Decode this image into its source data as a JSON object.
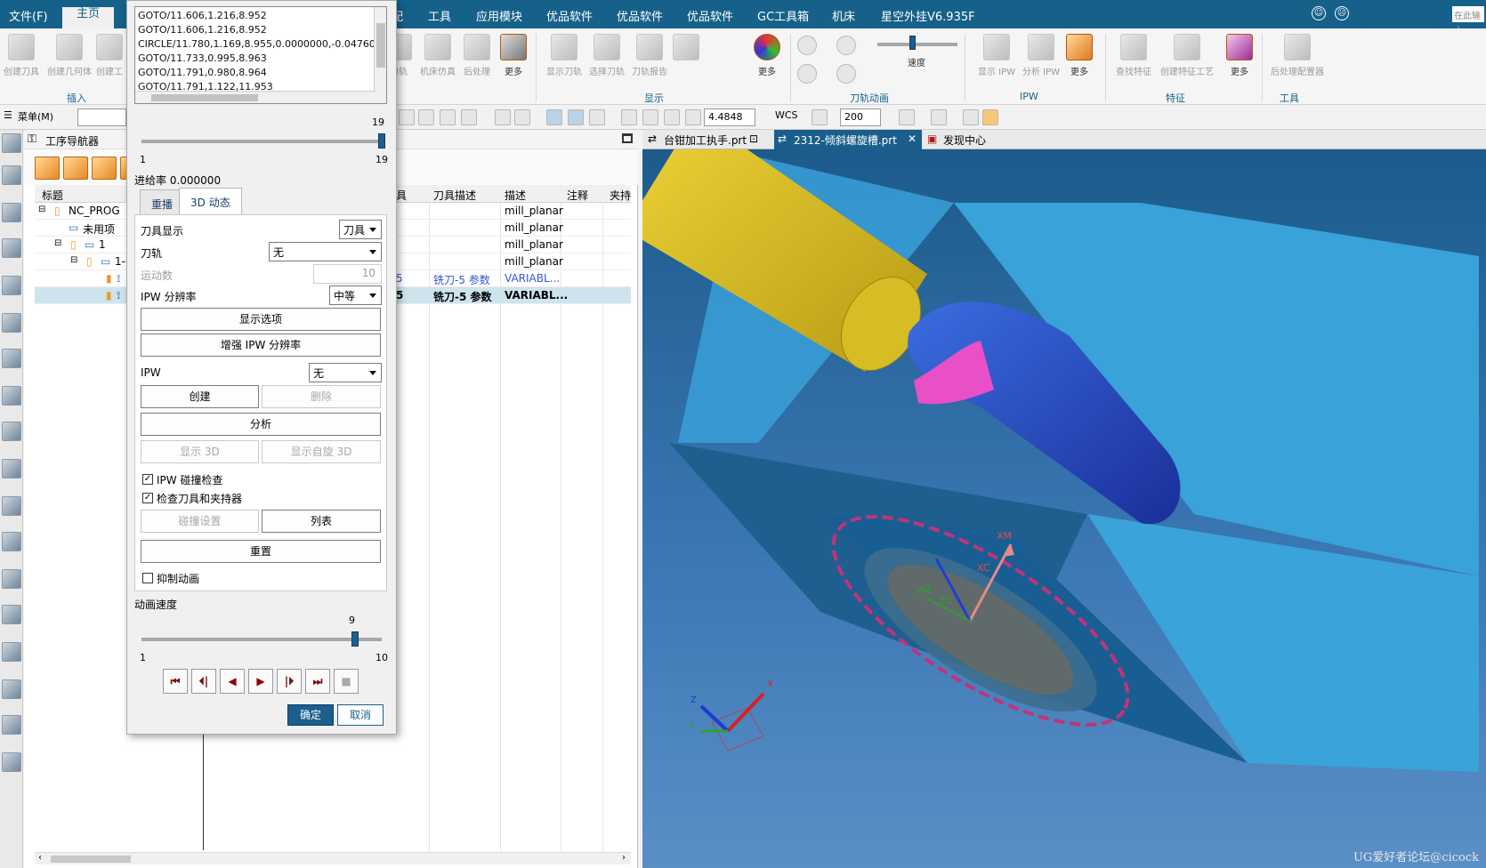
{
  "menubar": {
    "items": [
      "文件(F)",
      "主页",
      "配",
      "工具",
      "应用模块",
      "优品软件",
      "优品软件",
      "优品软件",
      "GC工具箱",
      "机床",
      "星空外挂V6.935F"
    ],
    "search_placeholder": "在此输入"
  },
  "ribbon": {
    "buttons": [
      "创建刀具",
      "创建几何体",
      "创建工",
      "刀轨",
      "机床仿真",
      "后处理",
      "更多",
      "显示刀轨",
      "选择刀轨",
      "刀轨报告",
      "更多",
      "速度",
      "显示 IPW",
      "分析 IPW",
      "更多",
      "查找特征",
      "创建特征工艺",
      "更多",
      "后处理配置器"
    ],
    "groups": [
      "插入",
      "显示",
      "刀轨动画",
      "IPW",
      "特征",
      "工具"
    ]
  },
  "toolbar2": {
    "menu_label": "菜单(M)",
    "zoom_value": "4.4848",
    "wcs_label": "WCS",
    "count_value": "200"
  },
  "navigator": {
    "title": "工序导航器",
    "columns": [
      "标题",
      "具",
      "刀具描述",
      "描述",
      "注释",
      "夹持"
    ],
    "rows": [
      {
        "name": "NC_PROG",
        "tool": "",
        "tooldesc": "",
        "desc": "mill_planar",
        "note": ""
      },
      {
        "name": "未用项",
        "tool": "",
        "tooldesc": "",
        "desc": "mill_planar",
        "note": ""
      },
      {
        "name": "1",
        "tool": "",
        "tooldesc": "",
        "desc": "mill_planar",
        "note": ""
      },
      {
        "name": "1-0",
        "tool": "",
        "tooldesc": "",
        "desc": "mill_planar",
        "note": ""
      },
      {
        "name": "",
        "tool": "5",
        "tooldesc": "铣刀-5 参数",
        "desc": "VARIABL...",
        "note": ""
      },
      {
        "name": "",
        "tool": "5",
        "tooldesc": "铣刀-5 参数",
        "desc": "VARIABL...",
        "note": ""
      }
    ]
  },
  "dialog": {
    "goto_lines": [
      "GOTO/11.606,1.216,8.952",
      "GOTO/11.606,1.216,8.952",
      "CIRCLE/11.780,1.169,8.955,0.0000000,-0.04760640",
      "GOTO/11.733,0.995,8.963",
      "GOTO/11.791,0.980,8.964",
      "GOTO/11.791,1.122,11.953"
    ],
    "step_slider": {
      "min": "1",
      "max": "19",
      "value_label": "19",
      "value": 19
    },
    "feed_rate": "进给率 0.000000",
    "tabs": [
      "重播",
      "3D 动态"
    ],
    "tool_display_label": "刀具显示",
    "tool_display_value": "刀具",
    "toolpath_label": "刀轨",
    "toolpath_value": "无",
    "motions_label": "运动数",
    "motions_value": "10",
    "ipw_res_label": "IPW 分辨率",
    "ipw_res_value": "中等",
    "btn_display_options": "显示选项",
    "btn_increase_ipw": "增强 IPW 分辨率",
    "ipw_label": "IPW",
    "ipw_value": "无",
    "btn_create": "创建",
    "btn_delete": "删除",
    "btn_analyze": "分析",
    "btn_show3d": "显示 3D",
    "btn_show_free3d": "显示自旋 3D",
    "chk_ipw_collision": "IPW 碰撞检查",
    "chk_check_tool": "检查刀具和夹持器",
    "btn_collision_settings": "碰撞设置",
    "btn_list": "列表",
    "btn_reset": "重置",
    "chk_suppress": "抑制动画",
    "anim_speed_label": "动画速度",
    "speed_slider": {
      "min": "1",
      "max": "10",
      "value_label": "9",
      "value": 9
    },
    "play_buttons": [
      "⏮",
      "⏴|",
      "◀",
      "▶",
      "|⏵",
      "⏭",
      "■"
    ],
    "ok": "确定",
    "cancel": "取消"
  },
  "doctabs": [
    "台钳加工执手.prt",
    "2312-倾斜螺旋槽.prt",
    "发现中心"
  ],
  "viewport": {
    "axis_labels": [
      "XM",
      "XC",
      "YM",
      "YC",
      "X",
      "Z",
      "Y"
    ],
    "watermark": "UG爱好者论坛@cicock"
  },
  "colors": {
    "accent": "#15618a",
    "viewport_bg": "#2f6ea6",
    "block": "#3aa0d8",
    "tool_yellow": "#e0c21f",
    "tool_blue": "#2a4ad0"
  }
}
